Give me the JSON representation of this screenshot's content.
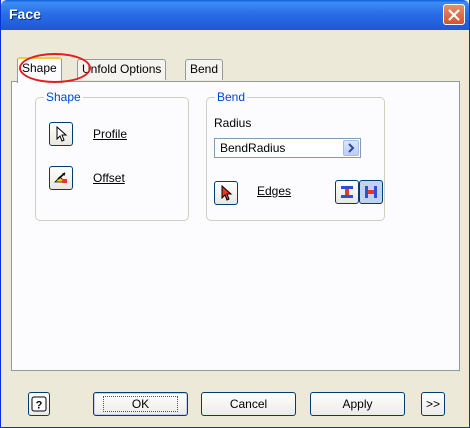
{
  "window": {
    "title": "Face"
  },
  "tabs": [
    {
      "label": "Shape",
      "active": true
    },
    {
      "label": "Unfold Options",
      "active": false
    },
    {
      "label": "Bend",
      "active": false
    }
  ],
  "shape_group": {
    "label": "Shape",
    "profile_label": "Profile",
    "offset_label": "Offset"
  },
  "bend_group": {
    "label": "Bend",
    "radius_label": "Radius",
    "radius_value": "BendRadius",
    "edges_label": "Edges"
  },
  "buttons": {
    "help": "?",
    "ok": "OK",
    "cancel": "Cancel",
    "apply": "Apply",
    "more": ">>"
  },
  "colors": {
    "accent": "#0046d5",
    "title_bar": "#2a6ee8",
    "annotation": "#e21e1e"
  }
}
